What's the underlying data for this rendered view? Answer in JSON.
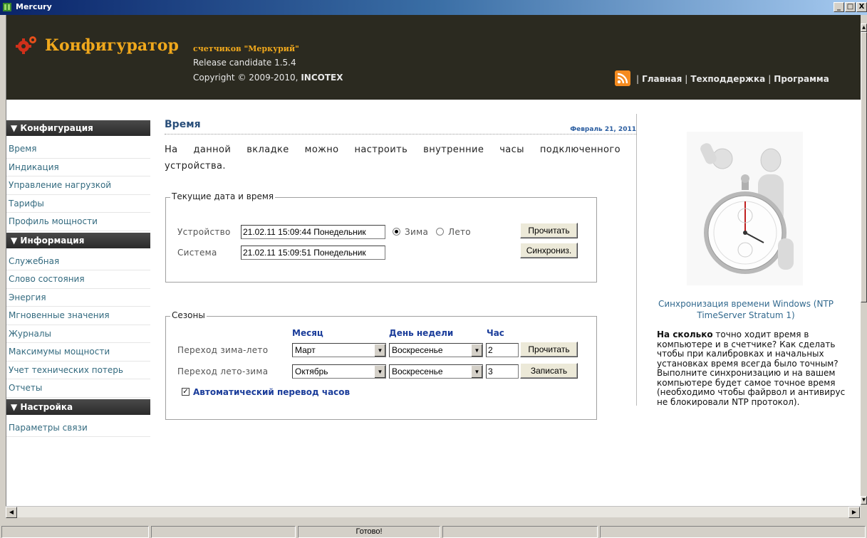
{
  "window": {
    "title": "Mercury",
    "controls": [
      "_",
      "□",
      "X"
    ]
  },
  "header": {
    "app_title": "Конфигуратор",
    "subtitle": "счетчиков \"Меркурий\"",
    "release": "Release candidate 1.5.4",
    "copyright": "Copyright © 2009-2010,",
    "copyright_company": "INCOTEX",
    "nav": {
      "sep": "|",
      "home": "Главная",
      "support": "Техподдержка",
      "program": "Программа"
    },
    "accent_color": "#f0a81c",
    "rss_icon": "rss-icon"
  },
  "sidebar": {
    "sections": [
      {
        "title": "▼ Конфигурация",
        "items": [
          "Время",
          "Индикация",
          "Управление нагрузкой",
          "Тарифы",
          "Профиль мощности"
        ]
      },
      {
        "title": "▼ Информация",
        "items": [
          "Служебная",
          "Слово состояния",
          "Энергия",
          "Мгновенные значения",
          "Журналы",
          "Максимумы мощности",
          "Учет технических потерь",
          "Отчеты"
        ]
      },
      {
        "title": "▼ Настройка",
        "items": [
          "Параметры связи"
        ]
      }
    ]
  },
  "main": {
    "title": "Время",
    "date": "Февраль 21, 2011",
    "intro": "На данной вкладке можно настроить внутренние часы подключенного устройства.",
    "datetime_group": {
      "legend": "Текущие дата и время",
      "device_label": "Устройство",
      "device_value": "21.02.11  15:09:44  Понедельник",
      "system_label": "Система",
      "system_value": "21.02.11  15:09:51  Понедельник",
      "radio_winter": "Зима",
      "radio_summer": "Лето",
      "read_button": "Прочитать",
      "sync_button": "Синхрониз."
    },
    "seasons_group": {
      "legend": "Сезоны",
      "col_month": "Месяц",
      "col_weekday": "День недели",
      "col_hour": "Час",
      "rows": [
        {
          "label": "Переход зима-лето",
          "month": "Март",
          "weekday": "Воскресенье",
          "hour": "2",
          "button": "Прочитать"
        },
        {
          "label": "Переход лето-зима",
          "month": "Октябрь",
          "weekday": "Воскресенье",
          "hour": "3",
          "button": "Записать"
        }
      ],
      "auto_dst_label": "Автоматический перевод часов",
      "auto_dst_checked": true
    }
  },
  "right_panel": {
    "ntp_link": "Синхронизация времени Windows (NTP TimeServer Stratum 1)",
    "promo_bold": "На сколько",
    "promo_text": " точно ходит время в компьютере и в счетчике? Как сделать чтобы при калибровках и начальных установках время всегда было точным? Выполните синхронизацию и на вашем компьютере будет самое точное время (необходимо чтобы файрвол и антивирус не блокировали NTP протокол)."
  },
  "statusbar": {
    "status": "Готово!"
  }
}
